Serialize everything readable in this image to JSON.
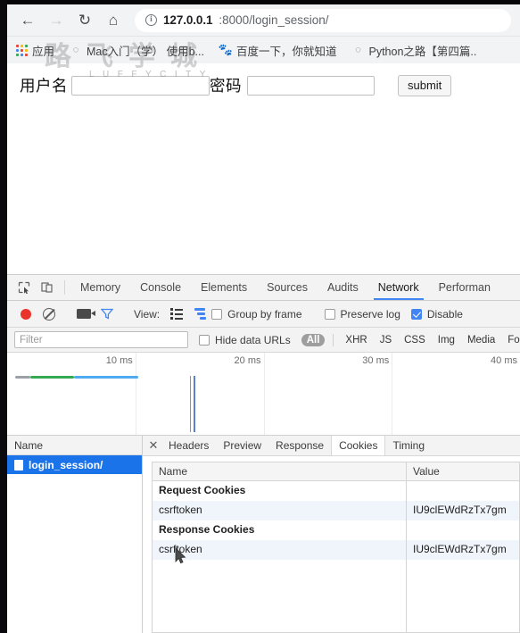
{
  "browser": {
    "nav": {
      "back_icon": "arrow-left",
      "forward_icon": "arrow-right",
      "reload_icon": "reload",
      "home_icon": "home"
    },
    "omnibox": {
      "info_glyph": "i",
      "url_host": "127.0.0.1",
      "url_rest": ":8000/login_session/"
    },
    "bookmarks": [
      {
        "label": "应用",
        "icon": "apps-grid-icon"
      },
      {
        "label": "Mac入门（学） 使用b...",
        "icon": "bookmark-icon"
      },
      {
        "label": "百度一下，你就知道",
        "icon": "baidu-icon"
      },
      {
        "label": "Python之路【第四篇..",
        "icon": "bookmark-icon"
      }
    ]
  },
  "page": {
    "username_label": "用户名",
    "username_value": "",
    "username_placeholder": "",
    "password_label": "密码",
    "password_value": "",
    "password_placeholder": "",
    "submit_label": "submit",
    "watermark_cn": "路飞学城",
    "watermark_en": "LUFFYCITY"
  },
  "devtools": {
    "tabs": [
      {
        "label": "Memory",
        "active": false
      },
      {
        "label": "Console",
        "active": false
      },
      {
        "label": "Elements",
        "active": false
      },
      {
        "label": "Sources",
        "active": false
      },
      {
        "label": "Audits",
        "active": false
      },
      {
        "label": "Network",
        "active": true
      },
      {
        "label": "Performan",
        "active": false
      }
    ],
    "toolbar": {
      "record_icon": "record-dot-icon",
      "clear_icon": "clear-icon",
      "camera_icon": "camera-icon",
      "filter_icon": "funnel-icon",
      "view_label": "View:",
      "list_view_icon": "list-view-icon",
      "waterfall_view_icon": "waterfall-view-icon",
      "group_by_frame_label": "Group by frame",
      "group_by_frame_checked": false,
      "preserve_log_label": "Preserve log",
      "preserve_log_checked": false,
      "disable_cache_label": "Disable",
      "disable_cache_checked": true
    },
    "filterbar": {
      "filter_placeholder": "Filter",
      "filter_value": "",
      "hide_data_urls_label": "Hide data URLs",
      "hide_data_urls_checked": false,
      "types": [
        {
          "label": "All",
          "active": true
        },
        {
          "label": "XHR",
          "active": false
        },
        {
          "label": "JS",
          "active": false
        },
        {
          "label": "CSS",
          "active": false
        },
        {
          "label": "Img",
          "active": false
        },
        {
          "label": "Media",
          "active": false
        },
        {
          "label": "Font",
          "active": false
        }
      ]
    },
    "overview": {
      "ticks": [
        "10 ms",
        "20 ms",
        "30 ms",
        "40 ms"
      ],
      "bar_segments": [
        {
          "color": "#9aa0a6",
          "left_pct": 1.5,
          "width_pct": 3.0
        },
        {
          "color": "#34a853",
          "left_pct": 4.5,
          "width_pct": 8.5
        },
        {
          "color": "#4faaef",
          "left_pct": 13.0,
          "width_pct": 12.5
        }
      ],
      "event_lines": [
        {
          "color": "#ef6c5a",
          "left_pct": 35.6
        },
        {
          "color": "#5b7fd4",
          "left_pct": 36.4
        }
      ]
    },
    "requests": {
      "column_header": "Name",
      "rows": [
        {
          "name": "login_session/",
          "selected": true,
          "icon": "document-icon"
        }
      ]
    },
    "detail": {
      "close_icon": "close-icon",
      "tabs": [
        {
          "label": "Headers",
          "active": false
        },
        {
          "label": "Preview",
          "active": false
        },
        {
          "label": "Response",
          "active": false
        },
        {
          "label": "Cookies",
          "active": true
        },
        {
          "label": "Timing",
          "active": false
        }
      ],
      "cookies_table": {
        "columns": [
          "Name",
          "Value"
        ],
        "rows": [
          {
            "kind": "group",
            "name": "Request Cookies",
            "value": ""
          },
          {
            "kind": "cookie",
            "name": "csrftoken",
            "value": "IU9clEWdRzTx7gm"
          },
          {
            "kind": "group",
            "name": "Response Cookies",
            "value": ""
          },
          {
            "kind": "cookie",
            "name": "csrftoken",
            "value": "IU9clEWdRzTx7gm"
          }
        ]
      }
    }
  }
}
